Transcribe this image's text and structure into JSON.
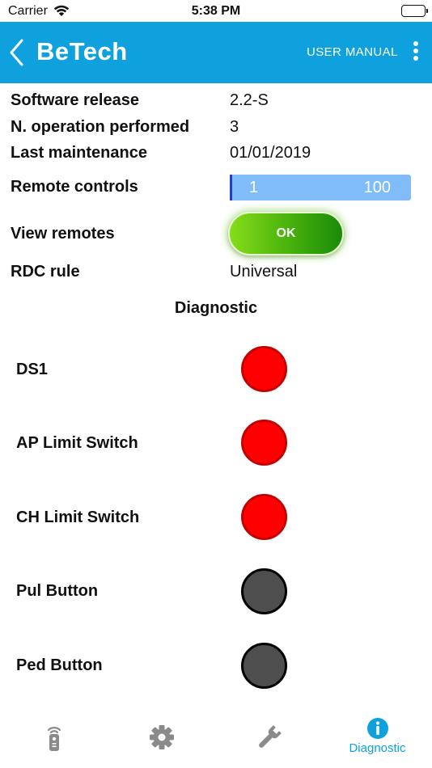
{
  "status_bar": {
    "carrier": "Carrier",
    "time": "5:38 PM"
  },
  "nav": {
    "title": "BeTech",
    "manual_label": "USER MANUAL"
  },
  "info": {
    "software_release": {
      "label": "Software release",
      "value": "2.2-S"
    },
    "operations": {
      "label": "N. operation performed",
      "value": "3"
    },
    "maintenance": {
      "label": "Last maintenance",
      "value": "01/01/2019"
    },
    "remote_controls": {
      "label": "Remote controls",
      "min": "1",
      "max": "100"
    },
    "view_remotes": {
      "label": "View remotes",
      "button_label": "OK"
    },
    "rdc_rule": {
      "label": "RDC rule",
      "value": "Universal"
    }
  },
  "diagnostic": {
    "title": "Diagnostic",
    "items": [
      {
        "label": "DS1",
        "state": "red"
      },
      {
        "label": "AP Limit Switch",
        "state": "red"
      },
      {
        "label": "CH Limit Switch",
        "state": "red"
      },
      {
        "label": "Pul Button",
        "state": "off"
      },
      {
        "label": "Ped Button",
        "state": "off"
      }
    ]
  },
  "tabs": [
    {
      "icon": "remote-control-icon"
    },
    {
      "icon": "gear-icon"
    },
    {
      "icon": "wrench-icon"
    },
    {
      "icon": "info-icon",
      "label": "Diagnostic",
      "active": true
    }
  ],
  "colors": {
    "primary": "#0fa1de",
    "led_red": "#ff0000",
    "led_off": "#4e4e4e",
    "range_fill": "#7fbcf8",
    "ok_green": "#4cb40d",
    "inactive_icon": "#8a8a8a"
  }
}
